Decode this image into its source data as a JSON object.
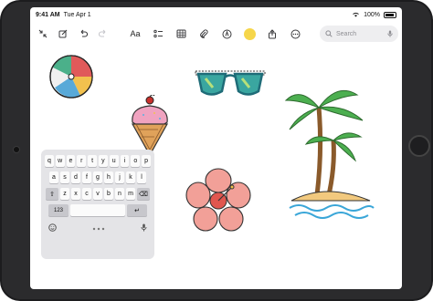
{
  "status_bar": {
    "time": "9:41 AM",
    "date": "Tue Apr 1",
    "battery": "100%"
  },
  "toolbar": {
    "text_format_label": "Aa",
    "search_placeholder": "Search"
  },
  "keyboard": {
    "row1": [
      "q",
      "w",
      "e",
      "r",
      "t",
      "y",
      "u",
      "i",
      "o",
      "p"
    ],
    "row2": [
      "a",
      "s",
      "d",
      "f",
      "g",
      "h",
      "j",
      "k",
      "l"
    ],
    "row3": [
      "z",
      "x",
      "c",
      "v",
      "b",
      "n",
      "m"
    ],
    "num_key": "123",
    "return_key": "↵",
    "shift_key": "⇧",
    "delete_key": "⌫"
  },
  "icons": {
    "collapse": "collapse-arrows-icon",
    "compose": "compose-icon",
    "undo": "undo-icon",
    "redo": "redo-icon",
    "checklist": "checklist-icon",
    "table": "table-icon",
    "attachment": "paperclip-icon",
    "markup": "markup-pen-icon",
    "highlight": "highlighter-icon",
    "share": "share-icon",
    "more": "more-icon",
    "search": "search-icon",
    "mic": "microphone-icon",
    "emoji": "emoji-icon"
  },
  "colors": {
    "highlight": "#f6d64a",
    "accent": "#007aff"
  }
}
